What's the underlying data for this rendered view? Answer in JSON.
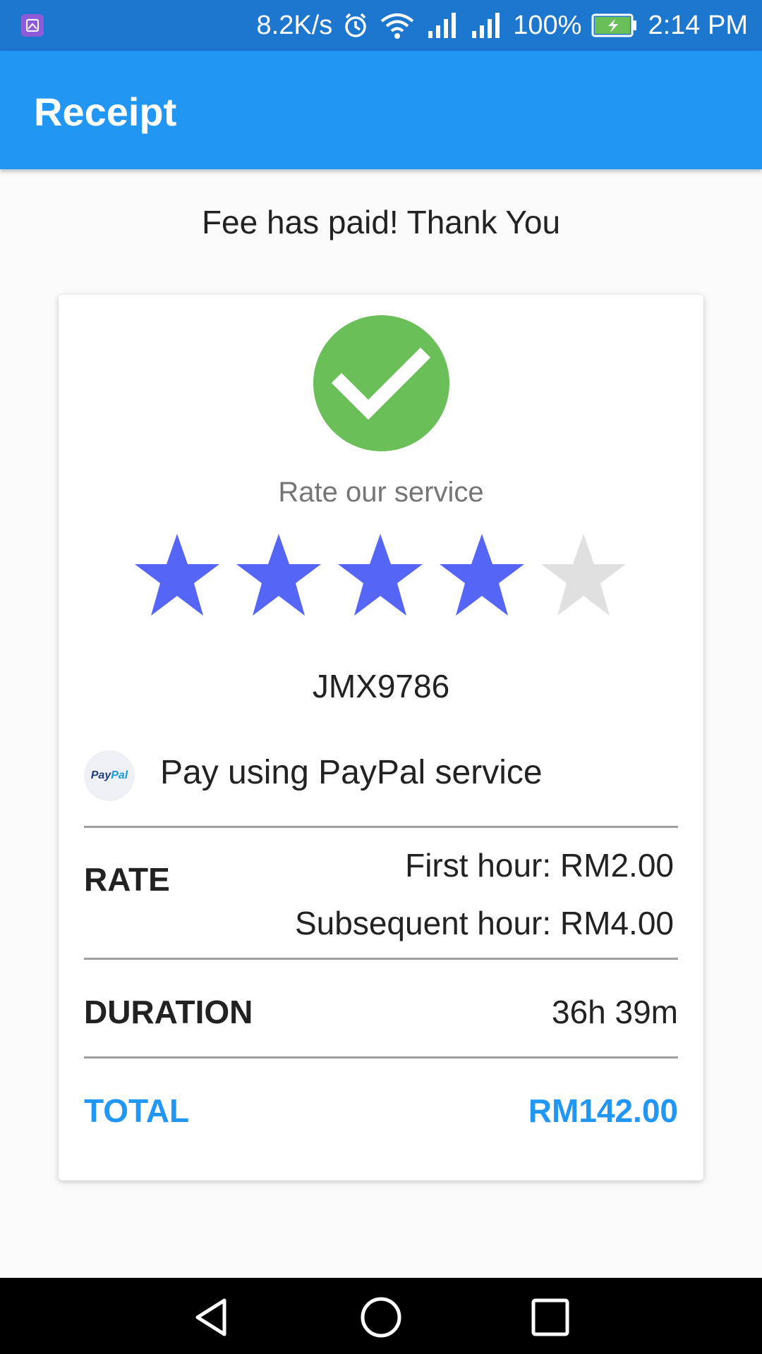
{
  "status_bar": {
    "net_speed": "8.2K/s",
    "battery": "100%",
    "time": "2:14 PM",
    "icons": [
      "app-icon",
      "alarm-icon",
      "wifi-icon",
      "signal-icon",
      "signal-icon",
      "battery-charging-icon"
    ]
  },
  "app_bar": {
    "title": "Receipt"
  },
  "message": "Fee has paid! Thank You",
  "card": {
    "icon": "check-circle-icon",
    "rate_label": "Rate our service",
    "rating": {
      "value": 4,
      "max": 5
    },
    "plate_number": "JMX9786",
    "payment": {
      "logo_text_1": "Pay",
      "logo_text_2": "Pal",
      "text": "Pay using PayPal service"
    },
    "rate": {
      "label": "RATE",
      "first_hour": "First hour: RM2.00",
      "subsequent_hour": "Subsequent hour: RM4.00"
    },
    "duration": {
      "label": "DURATION",
      "value": "36h 39m"
    },
    "total": {
      "label": "TOTAL",
      "value": "RM142.00"
    }
  },
  "colors": {
    "status_bar": "#1e77cf",
    "app_bar": "#2196f3",
    "check": "#6abf59",
    "star_on": "#5566f6",
    "star_off": "#e0e0e0",
    "total": "#2196f3"
  },
  "nav_bar": {
    "icons": [
      "back-icon",
      "home-icon",
      "recents-icon"
    ]
  }
}
